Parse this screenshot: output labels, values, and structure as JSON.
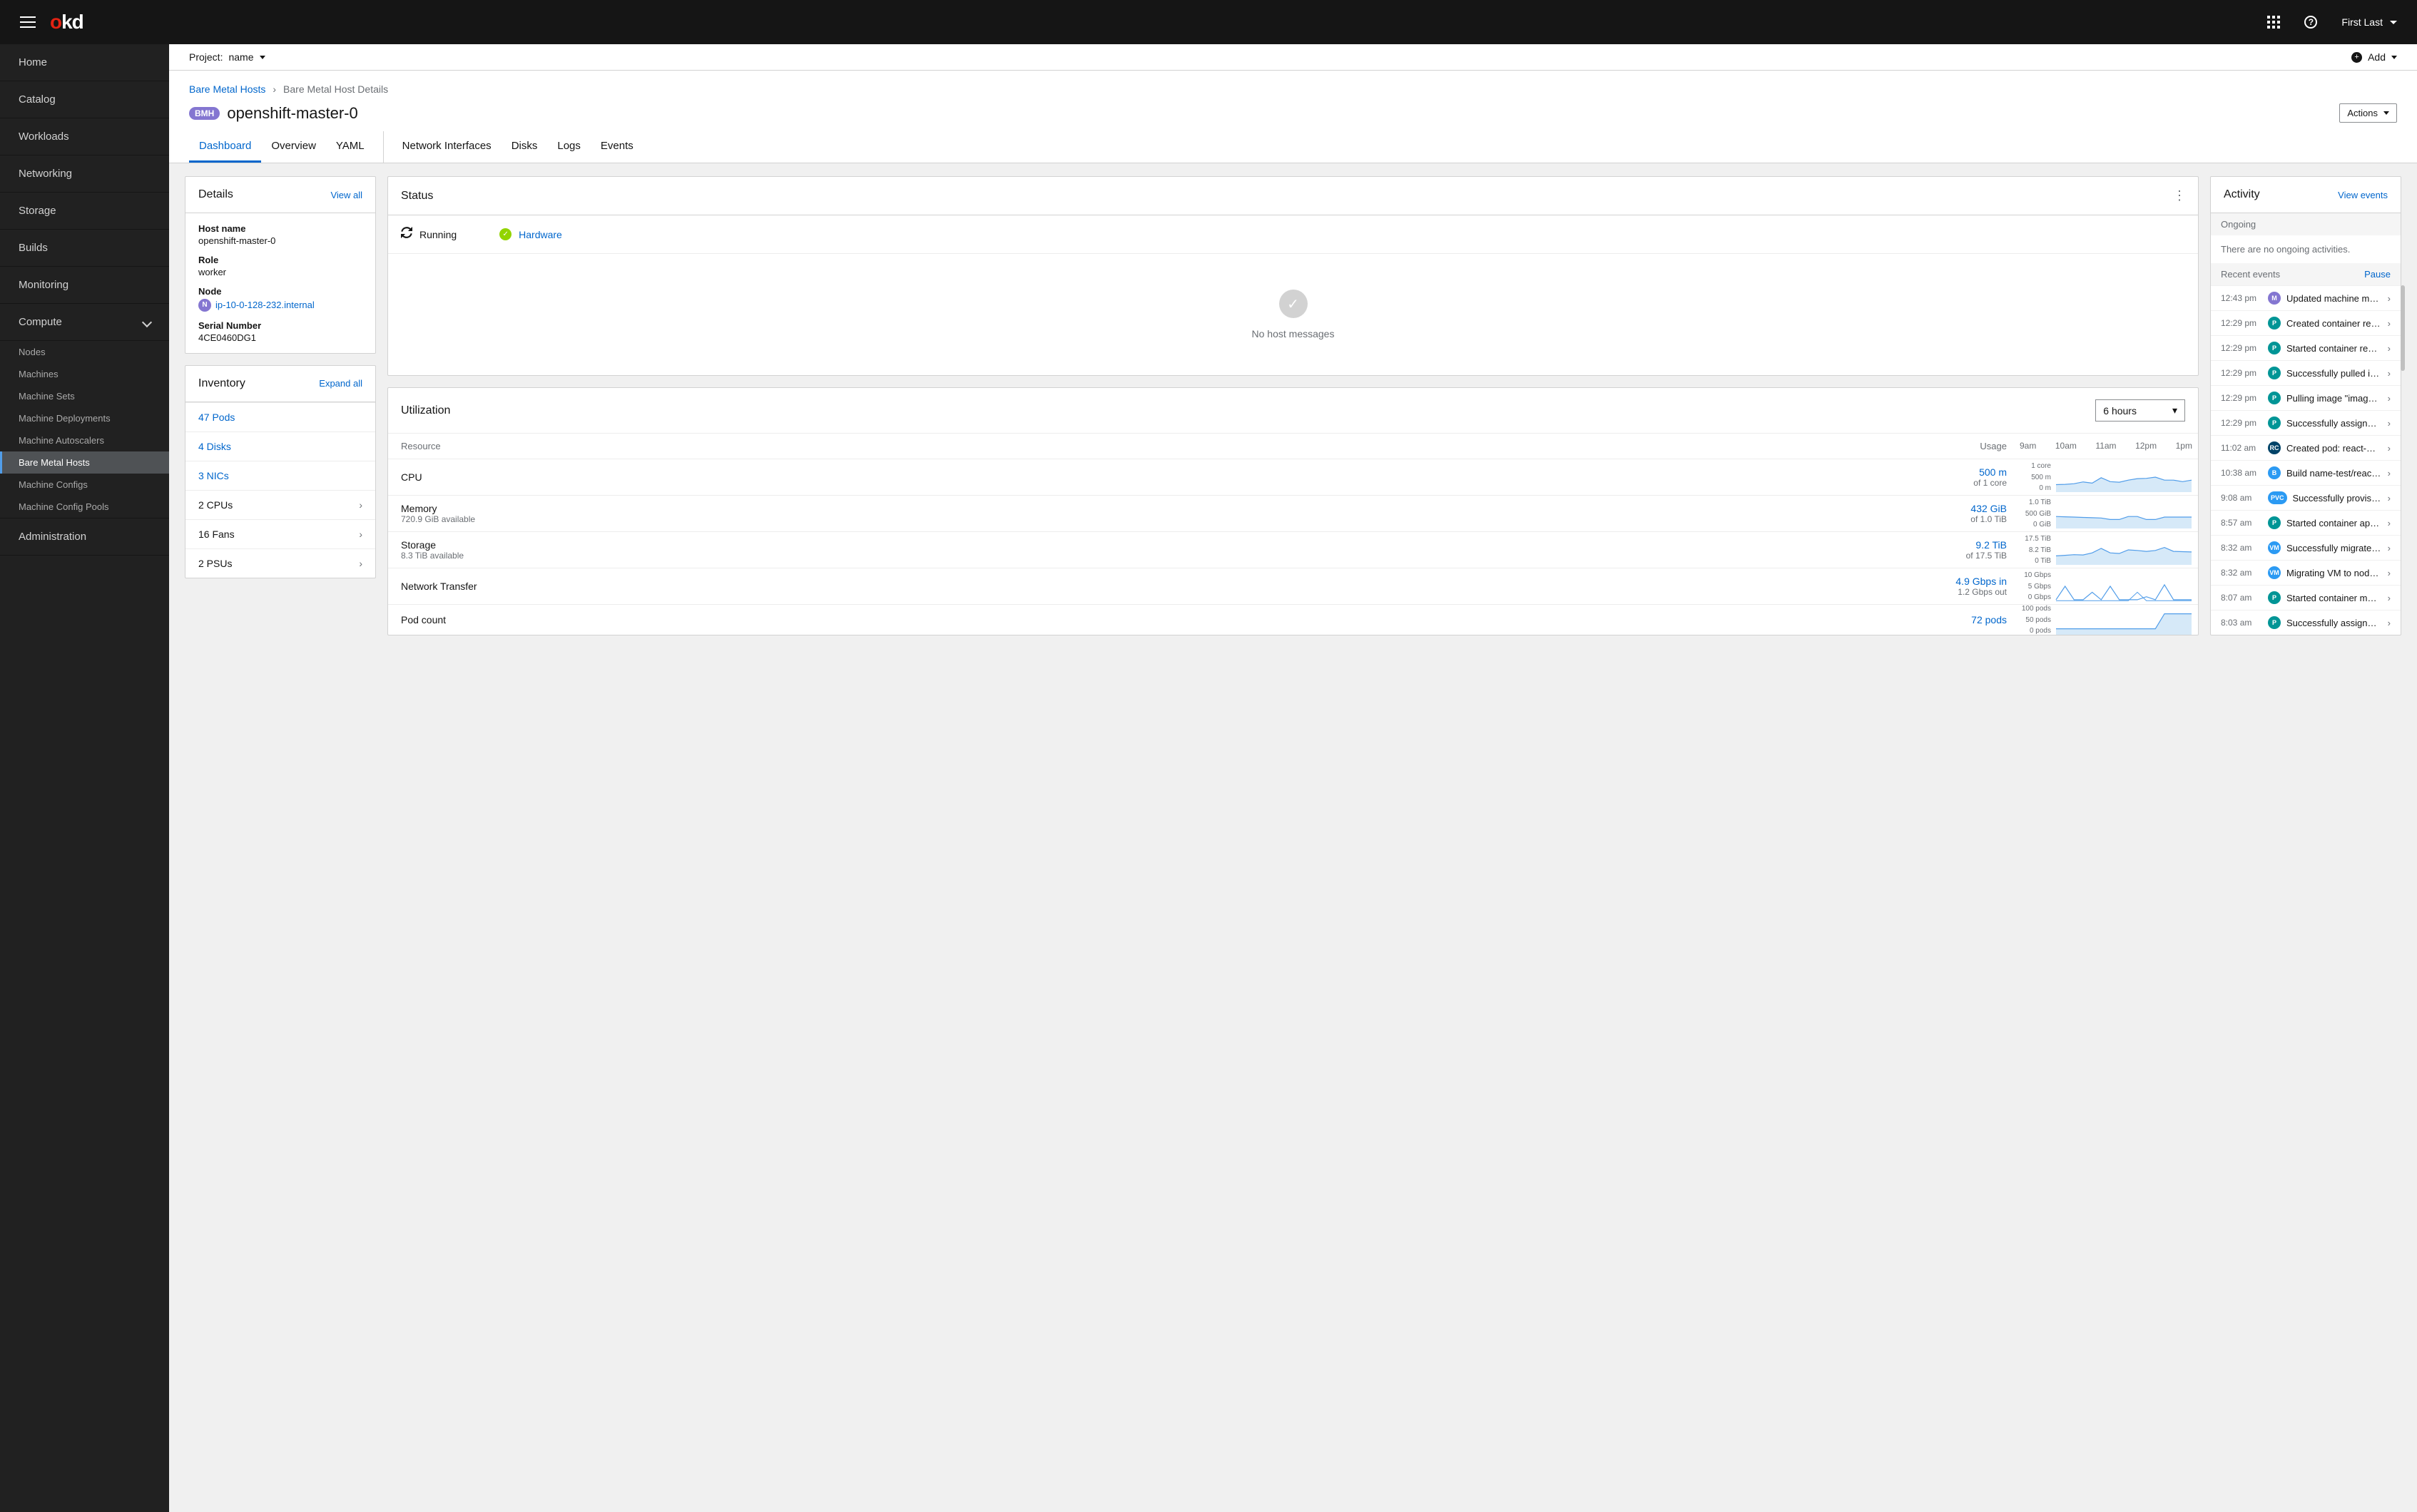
{
  "header": {
    "logo_o": "o",
    "logo_kd": "kd",
    "user": "First Last"
  },
  "sidebar": {
    "items": [
      {
        "label": "Home"
      },
      {
        "label": "Catalog"
      },
      {
        "label": "Workloads"
      },
      {
        "label": "Networking"
      },
      {
        "label": "Storage"
      },
      {
        "label": "Builds"
      },
      {
        "label": "Monitoring"
      }
    ],
    "compute": {
      "label": "Compute",
      "children": [
        {
          "label": "Nodes"
        },
        {
          "label": "Machines"
        },
        {
          "label": "Machine Sets"
        },
        {
          "label": "Machine Deployments"
        },
        {
          "label": "Machine Autoscalers"
        },
        {
          "label": "Bare Metal Hosts",
          "active": true
        },
        {
          "label": "Machine Configs"
        },
        {
          "label": "Machine Config Pools"
        }
      ]
    },
    "admin": {
      "label": "Administration"
    }
  },
  "project_bar": {
    "project_label": "Project:",
    "project_name": "name",
    "add_label": "Add"
  },
  "breadcrumb": {
    "parent": "Bare Metal Hosts",
    "current": "Bare Metal Host Details"
  },
  "page": {
    "badge": "BMH",
    "title": "openshift-master-0",
    "actions": "Actions"
  },
  "tabs": [
    "Dashboard",
    "Overview",
    "YAML",
    "Network Interfaces",
    "Disks",
    "Logs",
    "Events"
  ],
  "details_card": {
    "title": "Details",
    "view_all": "View all",
    "host_name_label": "Host name",
    "host_name": "openshift-master-0",
    "role_label": "Role",
    "role": "worker",
    "node_label": "Node",
    "node_badge": "N",
    "node": "ip-10-0-128-232.internal",
    "serial_label": "Serial Number",
    "serial": "4CE0460DG1"
  },
  "inventory_card": {
    "title": "Inventory",
    "expand": "Expand all",
    "rows": [
      {
        "text": "47 Pods",
        "link": true
      },
      {
        "text": "4 Disks",
        "link": true
      },
      {
        "text": "3 NICs",
        "link": true
      },
      {
        "text": "2 CPUs",
        "link": false,
        "chev": true
      },
      {
        "text": "16 Fans",
        "link": false,
        "chev": true
      },
      {
        "text": "2 PSUs",
        "link": false,
        "chev": true
      }
    ]
  },
  "status_card": {
    "title": "Status",
    "running": "Running",
    "hardware": "Hardware",
    "empty": "No host messages"
  },
  "utilization": {
    "title": "Utilization",
    "duration": "6 hours",
    "resource_col": "Resource",
    "usage_col": "Usage",
    "xticks": [
      "9am",
      "10am",
      "11am",
      "12pm",
      "1pm"
    ],
    "rows": [
      {
        "name": "CPU",
        "sub": "",
        "val": "500 m",
        "valsub": "of 1 core",
        "yt": [
          "1 core",
          "500 m",
          "0 m"
        ],
        "series": [
          0.25,
          0.26,
          0.28,
          0.34,
          0.3,
          0.48,
          0.35,
          0.33,
          0.4,
          0.45,
          0.46,
          0.5,
          0.4,
          0.4,
          0.35,
          0.4
        ]
      },
      {
        "name": "Memory",
        "sub": "720.9 GiB available",
        "val": "432 GiB",
        "valsub": "of 1.0 TiB",
        "yt": [
          "1.0 TiB",
          "500 GiB",
          "0 GiB"
        ],
        "series": [
          0.4,
          0.39,
          0.38,
          0.37,
          0.36,
          0.35,
          0.3,
          0.3,
          0.4,
          0.4,
          0.3,
          0.3,
          0.38,
          0.38,
          0.38,
          0.38
        ]
      },
      {
        "name": "Storage",
        "sub": "8.3 TiB available",
        "val": "9.2 TiB",
        "valsub": "of 17.5 TiB",
        "yt": [
          "17.5 TiB",
          "8.2 TiB",
          "0 TiB"
        ],
        "series": [
          0.3,
          0.32,
          0.34,
          0.33,
          0.4,
          0.55,
          0.4,
          0.38,
          0.5,
          0.48,
          0.45,
          0.48,
          0.58,
          0.45,
          0.44,
          0.43
        ]
      },
      {
        "name": "Network Transfer",
        "sub": "",
        "val": "4.9 Gbps in",
        "valsub": "1.2 Gbps out",
        "yt": [
          "10 Gbps",
          "5 Gbps",
          "0 Gbps"
        ],
        "series": [
          0.05,
          0.5,
          0.05,
          0.05,
          0.3,
          0.05,
          0.5,
          0.05,
          0.05,
          0.05,
          0.15,
          0.05,
          0.55,
          0.05,
          0.05,
          0.05
        ],
        "series2": [
          0.02,
          0.02,
          0.02,
          0.02,
          0.02,
          0.02,
          0.02,
          0.02,
          0.02,
          0.3,
          0.02,
          0.02,
          0.02,
          0.02,
          0.02,
          0.02
        ]
      },
      {
        "name": "Pod count",
        "sub": "",
        "val": "72 pods",
        "valsub": "",
        "yt": [
          "100 pods",
          "50 pods",
          "0 pods"
        ],
        "series": [
          0.2,
          0.2,
          0.2,
          0.2,
          0.2,
          0.2,
          0.2,
          0.2,
          0.2,
          0.2,
          0.2,
          0.2,
          0.7,
          0.7,
          0.7,
          0.7
        ]
      }
    ]
  },
  "activity": {
    "title": "Activity",
    "view_events": "View events",
    "ongoing_h": "Ongoing",
    "ongoing_empty": "There are no ongoing activities.",
    "recent_h": "Recent events",
    "pause": "Pause",
    "events": [
      {
        "t": "12:43 pm",
        "b": "M",
        "c": "#8476D1",
        "txt": "Updated machine mynam…"
      },
      {
        "t": "12:29 pm",
        "b": "P",
        "c": "#009596",
        "txt": "Created container reacta…"
      },
      {
        "t": "12:29 pm",
        "b": "P",
        "c": "#009596",
        "txt": "Started container reacta…"
      },
      {
        "t": "12:29 pm",
        "b": "P",
        "c": "#009596",
        "txt": "Successfully pulled imag…"
      },
      {
        "t": "12:29 pm",
        "b": "P",
        "c": "#009596",
        "txt": "Pulling image \"image-re…"
      },
      {
        "t": "12:29 pm",
        "b": "P",
        "c": "#009596",
        "txt": "Successfully assigned ap…"
      },
      {
        "t": "11:02 am",
        "b": "RC",
        "c": "#004368",
        "txt": "Created pod: react-web-…"
      },
      {
        "t": "10:38 am",
        "b": "B",
        "c": "#2B9AF3",
        "txt": "Build name-test/react-we…"
      },
      {
        "t": "9:08 am",
        "b": "PVC",
        "c": "#2B9AF3",
        "txt": "Successfully provision…",
        "pill": true
      },
      {
        "t": "8:57 am",
        "b": "P",
        "c": "#009596",
        "txt": "Started container appde…"
      },
      {
        "t": "8:32 am",
        "b": "VM",
        "c": "#2B9AF3",
        "txt": "Successfully migrated V…"
      },
      {
        "t": "8:32 am",
        "b": "VM",
        "c": "#2B9AF3",
        "txt": "Migrating VM to node ip…"
      },
      {
        "t": "8:07 am",
        "b": "P",
        "c": "#009596",
        "txt": "Started container manag…"
      },
      {
        "t": "8:03 am",
        "b": "P",
        "c": "#009596",
        "txt": "Successfully assigned m…"
      }
    ]
  },
  "chart_data": [
    {
      "type": "area",
      "title": "CPU",
      "x": [
        "9am",
        "10am",
        "11am",
        "12pm",
        "1pm"
      ],
      "ylim": [
        0,
        1
      ],
      "ylabel": "cores",
      "series": [
        {
          "name": "CPU",
          "values": [
            0.25,
            0.26,
            0.28,
            0.34,
            0.3,
            0.48,
            0.35,
            0.33,
            0.4,
            0.45,
            0.46,
            0.5,
            0.4,
            0.4,
            0.35,
            0.4
          ]
        }
      ]
    },
    {
      "type": "area",
      "title": "Memory",
      "x": [
        "9am",
        "10am",
        "11am",
        "12pm",
        "1pm"
      ],
      "ylim": [
        0,
        1024
      ],
      "ylabel": "GiB",
      "series": [
        {
          "name": "Memory",
          "values": [
            410,
            400,
            390,
            380,
            370,
            360,
            310,
            310,
            410,
            410,
            310,
            310,
            390,
            390,
            390,
            390
          ]
        }
      ]
    },
    {
      "type": "area",
      "title": "Storage",
      "x": [
        "9am",
        "10am",
        "11am",
        "12pm",
        "1pm"
      ],
      "ylim": [
        0,
        17.5
      ],
      "ylabel": "TiB",
      "series": [
        {
          "name": "Storage",
          "values": [
            5.2,
            5.5,
            5.8,
            5.7,
            7.0,
            9.6,
            7.0,
            6.6,
            8.8,
            8.4,
            7.9,
            8.4,
            10.1,
            7.9,
            7.7,
            7.5
          ]
        }
      ]
    },
    {
      "type": "line",
      "title": "Network Transfer",
      "x": [
        "9am",
        "10am",
        "11am",
        "12pm",
        "1pm"
      ],
      "ylim": [
        0,
        10
      ],
      "ylabel": "Gbps",
      "series": [
        {
          "name": "in",
          "values": [
            0.5,
            5,
            0.5,
            0.5,
            3,
            0.5,
            5,
            0.5,
            0.5,
            0.5,
            1.5,
            0.5,
            5.5,
            0.5,
            0.5,
            0.5
          ]
        },
        {
          "name": "out",
          "values": [
            0.2,
            0.2,
            0.2,
            0.2,
            0.2,
            0.2,
            0.2,
            0.2,
            0.2,
            3,
            0.2,
            0.2,
            0.2,
            0.2,
            0.2,
            0.2
          ]
        }
      ]
    },
    {
      "type": "area",
      "title": "Pod count",
      "x": [
        "9am",
        "10am",
        "11am",
        "12pm",
        "1pm"
      ],
      "ylim": [
        0,
        100
      ],
      "ylabel": "pods",
      "series": [
        {
          "name": "pods",
          "values": [
            20,
            20,
            20,
            20,
            20,
            20,
            20,
            20,
            20,
            20,
            20,
            20,
            70,
            70,
            70,
            70
          ]
        }
      ]
    }
  ]
}
